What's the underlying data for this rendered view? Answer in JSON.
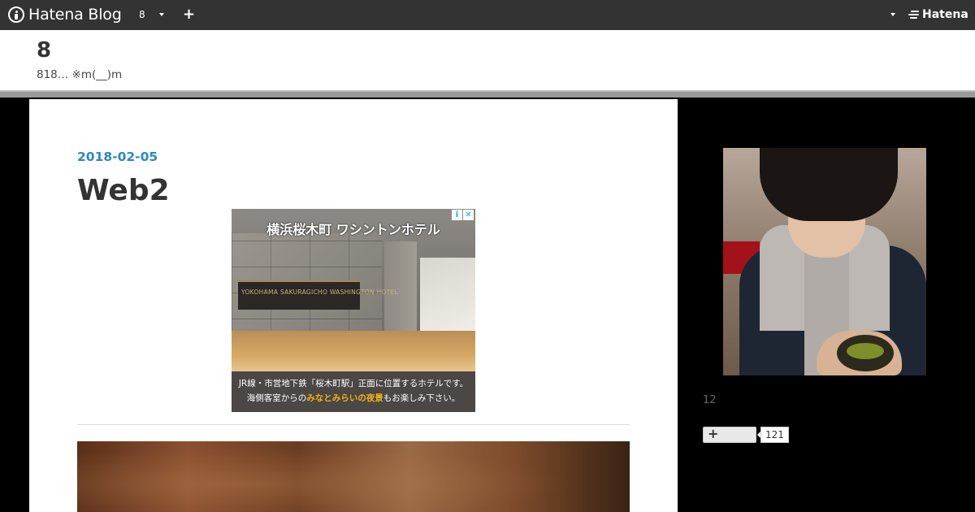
{
  "topbar": {
    "brand": "Hatena Blog",
    "blog_selector": "8",
    "add_label": "+",
    "hatena_logo": "Hatena"
  },
  "blog": {
    "title": "8",
    "description": "818… ※m(__)m"
  },
  "entry": {
    "date": "2018-02-05",
    "title": "Web2"
  },
  "ad": {
    "headline": "横浜桜木町 ワシントンホテル",
    "sign_text": "YOKOHAMA SAKURAGICHO WASHINGTON HOTEL",
    "caption_line1": "JR線・市営地下鉄「桜木町駅」正面に位置するホテルです。",
    "caption_line2_prefix": "海側客室からの",
    "caption_line2_highlight": "みなとみらいの夜景",
    "caption_line2_suffix": "もお楽しみ下さい。",
    "info_icon": "i",
    "close_icon": "✕"
  },
  "sidebar": {
    "count_text": "12",
    "subscribe_plus": "+",
    "subscriber_count": "121"
  }
}
